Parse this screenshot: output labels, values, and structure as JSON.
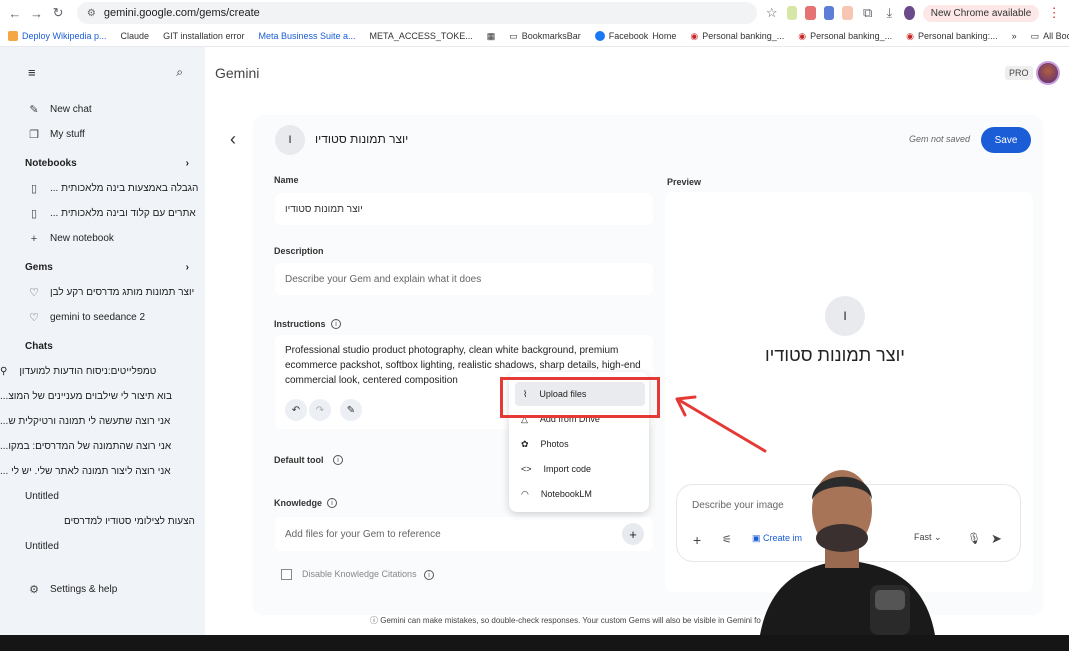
{
  "browser": {
    "url": "gemini.google.com/gems/create",
    "new_chrome": "New Chrome available",
    "bookmarks": [
      "Deploy Wikipedia p...",
      "Claude",
      "GIT installation error",
      "Meta Business Suite a...",
      "META_ACCESS_TOKE...",
      "BookmarksBar",
      "Facebook",
      "Home",
      "Personal banking_...",
      "Personal banking_...",
      "Personal banking:...",
      "All Bookmarks"
    ]
  },
  "sidebar": {
    "new_chat": "New chat",
    "my_stuff": "My stuff",
    "notebooks_title": "Notebooks",
    "notebooks": [
      "הגבלה באמצעות בינה מלאכותית ...",
      "אתרים עם קלוד ובינה מלאכותית ..."
    ],
    "new_notebook": "New notebook",
    "gems_title": "Gems",
    "gems": [
      "יוצר תמונות מותג מדרסים רקע לבן",
      "gemini to seedance 2"
    ],
    "chats_title": "Chats",
    "chats": [
      "טמפלייטים:ניסוח הודעות למועדון",
      "בוא תיצור לי שילבוים מעניינים של המוצ...",
      "אני רוצה שתעשה לי תמונה ורטיקלית ש...",
      "אני רוצה שהתמונה של המדרסים: במקו...",
      "אני רוצה ליצור תמונה לאתר שלי. יש לי ..."
    ],
    "untitled_1": "Untitled",
    "extra_chat": "הצעות לצילומי סטודיו למדרסים",
    "untitled_2": "Untitled",
    "settings": "Settings & help"
  },
  "header": {
    "title": "Gemini",
    "pro": "PRO"
  },
  "editor": {
    "gem_initial": "I",
    "gem_name": "יוצר תמונות סטודיו",
    "not_saved": "Gem not saved",
    "save": "Save",
    "name_label": "Name",
    "name_value": "יוצר תמונות סטודיו",
    "description_label": "Description",
    "description_placeholder": "Describe your Gem and explain what it does",
    "instructions_label": "Instructions",
    "instructions_text": "Professional studio product photography, clean white background, premium ecommerce packshot, softbox lighting, realistic shadows, sharp details, high-end commercial look, centered composition",
    "default_tool_label": "Default tool",
    "knowledge_label": "Knowledge",
    "knowledge_placeholder": "Add files for your Gem to reference",
    "disable_citations": "Disable Knowledge Citations"
  },
  "menu": {
    "items": [
      "Upload files",
      "Add from Drive",
      "Photos",
      "Import code",
      "NotebookLM"
    ]
  },
  "preview": {
    "label": "Preview",
    "title": "יוצר תמונות סטודיו",
    "initial": "I",
    "prompt_placeholder": "Describe your image",
    "create_image": "Create im",
    "mode": "Fast"
  },
  "footer": {
    "note": "Gemini can make mistakes, so double-check responses. Your custom Gems will also be visible in Gemini fo"
  },
  "colors": {
    "accent": "#1a5dd6",
    "highlight_box": "#e53935",
    "sidebar_bg": "#f0f4f9"
  }
}
